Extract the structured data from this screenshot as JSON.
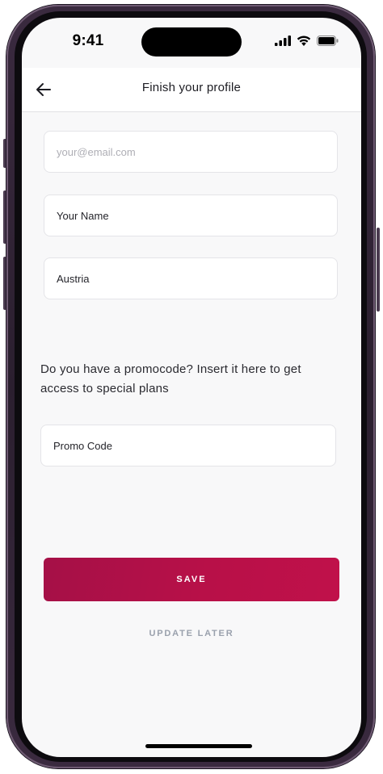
{
  "status_bar": {
    "time": "9:41",
    "icons": [
      "signal-icon",
      "wifi-icon",
      "battery-icon"
    ]
  },
  "header": {
    "back_icon": "arrow-left-icon",
    "title": "Finish your profile"
  },
  "form": {
    "email": {
      "placeholder": "your@email.com",
      "value": ""
    },
    "name": {
      "value": "Your Name"
    },
    "country": {
      "value": "Austria"
    },
    "promo_prompt": "Do you have a promocode? Insert it here to get access to special plans",
    "promo_code": {
      "value": "Promo Code"
    }
  },
  "actions": {
    "save_label": "SAVE",
    "later_label": "UPDATE LATER"
  },
  "colors": {
    "accent": "#b81048",
    "muted_button_text": "#9aa1ad",
    "screen_background": "#f8f8f9"
  }
}
